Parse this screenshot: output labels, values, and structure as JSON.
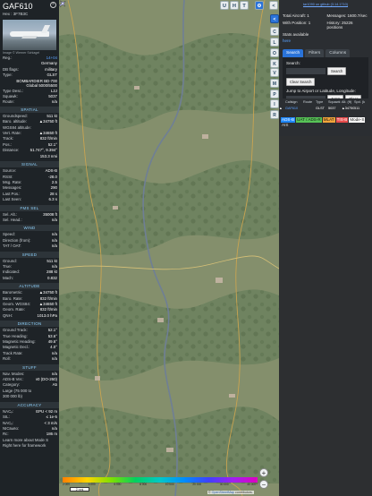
{
  "aircraft": {
    "callsign": "GAF610",
    "hex_label": "Hex :",
    "hex": "3F7B3C",
    "photo_credit": "Image © Werner Schlagel",
    "fields": [
      {
        "k": "Reg.:",
        "v": "14+04",
        "link": true
      },
      {
        "k": "",
        "v": "Germany"
      },
      {
        "k": "DB flags:",
        "v": "military"
      },
      {
        "k": "Type:",
        "v": "GLST"
      }
    ],
    "type_desc": [
      "BOMBARDIER BD-700",
      "Global 5000/5500"
    ],
    "fields2": [
      {
        "k": "Type Desc.:",
        "v": "L2J"
      },
      {
        "k": "Squawk:",
        "v": "5037"
      },
      {
        "k": "Route:",
        "v": "n/a"
      }
    ]
  },
  "sections": [
    {
      "title": "SPATIAL",
      "rows": [
        {
          "k": "Groundspeed:",
          "v": "511 kt"
        },
        {
          "k": "Baro. altitude:",
          "v": "▲34750 ft"
        },
        {
          "k": "WGS84 altitude:",
          "v": ""
        },
        {
          "k": "",
          "v": ""
        },
        {
          "k": "Vert. Rate:",
          "v": "▲34650 ft"
        },
        {
          "k": "Track:",
          "v": "832 ft/min"
        },
        {
          "k": "Pos.:",
          "v": "52.1°"
        },
        {
          "k": "Distance:",
          "v": "51.747°, 9.394°"
        },
        {
          "k": "",
          "v": "153.3 nmi"
        }
      ]
    },
    {
      "title": "SIGNAL",
      "rows": [
        {
          "k": "Source:",
          "v": "ADS-B"
        },
        {
          "k": "RSSI:",
          "v": "-28.0"
        },
        {
          "k": "Msg. Rate:",
          "v": "2.5"
        },
        {
          "k": "Messages:",
          "v": "290"
        },
        {
          "k": "Last Pos.:",
          "v": "28 s"
        },
        {
          "k": "Last Seen:",
          "v": "6.3 s"
        }
      ]
    },
    {
      "title": "FMS SEL",
      "rows": [
        {
          "k": "Sel. Alt.:",
          "v": "35008 ft"
        },
        {
          "k": "Sel. Head.:",
          "v": "n/a"
        }
      ]
    },
    {
      "title": "WIND",
      "rows": [
        {
          "k": "Speed:",
          "v": "n/a"
        },
        {
          "k": "Direction (from):",
          "v": "n/a"
        },
        {
          "k": "TAT / OAT:",
          "v": "n/a"
        }
      ]
    },
    {
      "title": "SPEED",
      "rows": [
        {
          "k": "Ground:",
          "v": "511 kt"
        },
        {
          "k": "True:",
          "v": "n/a"
        },
        {
          "k": "Indicated:",
          "v": "288 kt"
        },
        {
          "k": "Mach:",
          "v": "0.832"
        }
      ]
    },
    {
      "title": "ALTITUDE",
      "rows": [
        {
          "k": "Barometric:",
          "v": "▲34750 ft"
        },
        {
          "k": "Baro. Rate:",
          "v": "832 ft/min"
        },
        {
          "k": "Geom. WGS84:",
          "v": "▲34650 ft"
        },
        {
          "k": "Geom. Rate:",
          "v": "832 ft/min"
        },
        {
          "k": "QNH:",
          "v": "1013.0 hPa"
        }
      ]
    },
    {
      "title": "DIRECTION",
      "rows": [
        {
          "k": "Ground Track:",
          "v": "52.1°"
        },
        {
          "k": "True Heading:",
          "v": "53.6°"
        },
        {
          "k": "Magnetic Heading:",
          "v": "49.6°"
        },
        {
          "k": "Magnetic Decl.:",
          "v": "4.0°"
        },
        {
          "k": "Track Rate:",
          "v": "n/a"
        },
        {
          "k": "Roll:",
          "v": "n/a"
        }
      ]
    },
    {
      "title": "STUFF",
      "rows": [
        {
          "k": "Nav. Modes:",
          "v": "n/a"
        },
        {
          "k": "ADS-B Ver.:",
          "v": "v0 (DO-260)"
        },
        {
          "k": "Category:",
          "v": "A5"
        },
        {
          "k": "Large (75 000 to",
          "v": ""
        },
        {
          "k": "300 000 lb)",
          "v": ""
        }
      ]
    },
    {
      "title": "ACCURACY",
      "rows": [
        {
          "k": "NACₚ:",
          "v": "EPU < 92 m"
        },
        {
          "k": "SIL:",
          "v": "≤ 1e-5"
        },
        {
          "k": "NACᵥ:",
          "v": "< 3 m/s"
        },
        {
          "k": "NICʙᴀʀᴏ:",
          "v": "n/a"
        },
        {
          "k": "Rc:",
          "v": "186 m"
        },
        {
          "k": "Learn more about Mode S",
          "v": ""
        },
        {
          "k": "Right here for framework",
          "v": ""
        }
      ]
    }
  ],
  "map_buttons": {
    "u": "U",
    "h": "H",
    "t": "T"
  },
  "side_buttons": [
    "C",
    "L",
    "O",
    "K",
    "V",
    "M",
    "P",
    "I",
    "R"
  ],
  "zoom": {
    "in": "+",
    "out": "−"
  },
  "scale_label": "2 nmi",
  "attribution": {
    "text": "© ",
    "link": "OpenStreetMap",
    "suffix": " contributors."
  },
  "legend_labels": [
    "2 000",
    "4 000",
    "6 000",
    "8 000",
    "10 000",
    "20 000",
    "30 000",
    "40 000+"
  ],
  "panel": {
    "top_link": "tar1090 on github (3.14.1710)",
    "stats": [
      {
        "label": "Total Aircraft: 1",
        "blue": false
      },
      {
        "label": "Messages: 1600.7/sec",
        "blue": false
      },
      {
        "label": "With Position: 1",
        "blue": false
      },
      {
        "label": "History: 25226 positions",
        "blue": false
      },
      {
        "label": "Stats available",
        "blue": false
      },
      {
        "label": "",
        "blue": false
      },
      {
        "label": "here",
        "blue": true
      },
      {
        "label": "",
        "blue": false
      }
    ],
    "tabs": [
      "Search",
      "Filters",
      "Columns"
    ],
    "search_label": "Search:",
    "search_button": "Search",
    "clear_button": "Clear Search",
    "jump_label": "Jump to Airport or Latitude, Longitude:",
    "jump_button": "Jump",
    "clear2_button": "Clear",
    "columns": [
      "",
      "Callsign",
      "Route",
      "Type",
      "Squawk",
      "Alt. (ft)",
      "Spd. (kt)"
    ],
    "row": [
      "▲",
      "GAF610",
      "",
      "GLST",
      "5037",
      "▲34750",
      "511"
    ],
    "sources": [
      {
        "label": "ADS-B",
        "cls": "adsb"
      },
      {
        "label": "UAT / ADS-R",
        "cls": "uat"
      },
      {
        "label": "MLAT",
        "cls": "mlat"
      },
      {
        "label": "TIS-B",
        "cls": "tisb"
      },
      {
        "label": "Mode-S",
        "cls": "modes"
      },
      {
        "label": "AIS",
        "cls": "ais"
      }
    ]
  },
  "colors": {
    "accent": "#2a73d9",
    "section_title": "#8fd3ff",
    "link": "#5aa2ff"
  }
}
